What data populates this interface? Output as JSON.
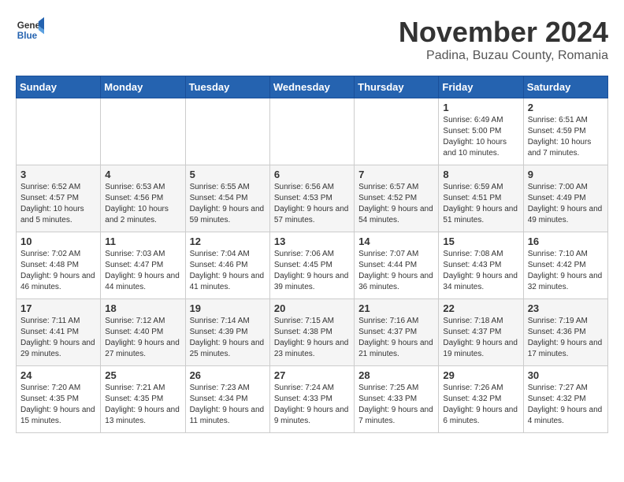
{
  "logo": {
    "general": "General",
    "blue": "Blue"
  },
  "title": "November 2024",
  "location": "Padina, Buzau County, Romania",
  "days_of_week": [
    "Sunday",
    "Monday",
    "Tuesday",
    "Wednesday",
    "Thursday",
    "Friday",
    "Saturday"
  ],
  "weeks": [
    [
      {
        "day": "",
        "info": ""
      },
      {
        "day": "",
        "info": ""
      },
      {
        "day": "",
        "info": ""
      },
      {
        "day": "",
        "info": ""
      },
      {
        "day": "",
        "info": ""
      },
      {
        "day": "1",
        "info": "Sunrise: 6:49 AM\nSunset: 5:00 PM\nDaylight: 10 hours and 10 minutes."
      },
      {
        "day": "2",
        "info": "Sunrise: 6:51 AM\nSunset: 4:59 PM\nDaylight: 10 hours and 7 minutes."
      }
    ],
    [
      {
        "day": "3",
        "info": "Sunrise: 6:52 AM\nSunset: 4:57 PM\nDaylight: 10 hours and 5 minutes."
      },
      {
        "day": "4",
        "info": "Sunrise: 6:53 AM\nSunset: 4:56 PM\nDaylight: 10 hours and 2 minutes."
      },
      {
        "day": "5",
        "info": "Sunrise: 6:55 AM\nSunset: 4:54 PM\nDaylight: 9 hours and 59 minutes."
      },
      {
        "day": "6",
        "info": "Sunrise: 6:56 AM\nSunset: 4:53 PM\nDaylight: 9 hours and 57 minutes."
      },
      {
        "day": "7",
        "info": "Sunrise: 6:57 AM\nSunset: 4:52 PM\nDaylight: 9 hours and 54 minutes."
      },
      {
        "day": "8",
        "info": "Sunrise: 6:59 AM\nSunset: 4:51 PM\nDaylight: 9 hours and 51 minutes."
      },
      {
        "day": "9",
        "info": "Sunrise: 7:00 AM\nSunset: 4:49 PM\nDaylight: 9 hours and 49 minutes."
      }
    ],
    [
      {
        "day": "10",
        "info": "Sunrise: 7:02 AM\nSunset: 4:48 PM\nDaylight: 9 hours and 46 minutes."
      },
      {
        "day": "11",
        "info": "Sunrise: 7:03 AM\nSunset: 4:47 PM\nDaylight: 9 hours and 44 minutes."
      },
      {
        "day": "12",
        "info": "Sunrise: 7:04 AM\nSunset: 4:46 PM\nDaylight: 9 hours and 41 minutes."
      },
      {
        "day": "13",
        "info": "Sunrise: 7:06 AM\nSunset: 4:45 PM\nDaylight: 9 hours and 39 minutes."
      },
      {
        "day": "14",
        "info": "Sunrise: 7:07 AM\nSunset: 4:44 PM\nDaylight: 9 hours and 36 minutes."
      },
      {
        "day": "15",
        "info": "Sunrise: 7:08 AM\nSunset: 4:43 PM\nDaylight: 9 hours and 34 minutes."
      },
      {
        "day": "16",
        "info": "Sunrise: 7:10 AM\nSunset: 4:42 PM\nDaylight: 9 hours and 32 minutes."
      }
    ],
    [
      {
        "day": "17",
        "info": "Sunrise: 7:11 AM\nSunset: 4:41 PM\nDaylight: 9 hours and 29 minutes."
      },
      {
        "day": "18",
        "info": "Sunrise: 7:12 AM\nSunset: 4:40 PM\nDaylight: 9 hours and 27 minutes."
      },
      {
        "day": "19",
        "info": "Sunrise: 7:14 AM\nSunset: 4:39 PM\nDaylight: 9 hours and 25 minutes."
      },
      {
        "day": "20",
        "info": "Sunrise: 7:15 AM\nSunset: 4:38 PM\nDaylight: 9 hours and 23 minutes."
      },
      {
        "day": "21",
        "info": "Sunrise: 7:16 AM\nSunset: 4:37 PM\nDaylight: 9 hours and 21 minutes."
      },
      {
        "day": "22",
        "info": "Sunrise: 7:18 AM\nSunset: 4:37 PM\nDaylight: 9 hours and 19 minutes."
      },
      {
        "day": "23",
        "info": "Sunrise: 7:19 AM\nSunset: 4:36 PM\nDaylight: 9 hours and 17 minutes."
      }
    ],
    [
      {
        "day": "24",
        "info": "Sunrise: 7:20 AM\nSunset: 4:35 PM\nDaylight: 9 hours and 15 minutes."
      },
      {
        "day": "25",
        "info": "Sunrise: 7:21 AM\nSunset: 4:35 PM\nDaylight: 9 hours and 13 minutes."
      },
      {
        "day": "26",
        "info": "Sunrise: 7:23 AM\nSunset: 4:34 PM\nDaylight: 9 hours and 11 minutes."
      },
      {
        "day": "27",
        "info": "Sunrise: 7:24 AM\nSunset: 4:33 PM\nDaylight: 9 hours and 9 minutes."
      },
      {
        "day": "28",
        "info": "Sunrise: 7:25 AM\nSunset: 4:33 PM\nDaylight: 9 hours and 7 minutes."
      },
      {
        "day": "29",
        "info": "Sunrise: 7:26 AM\nSunset: 4:32 PM\nDaylight: 9 hours and 6 minutes."
      },
      {
        "day": "30",
        "info": "Sunrise: 7:27 AM\nSunset: 4:32 PM\nDaylight: 9 hours and 4 minutes."
      }
    ]
  ]
}
